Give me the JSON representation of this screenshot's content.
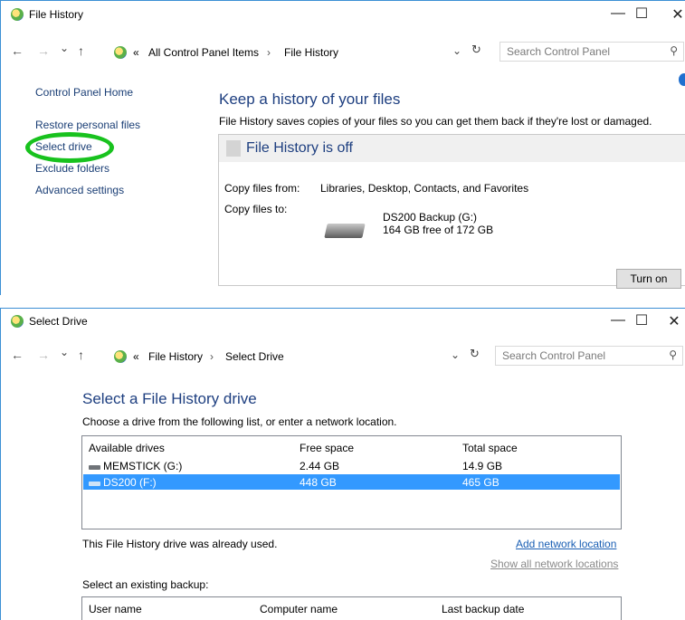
{
  "win1": {
    "title": "File History",
    "controls": {
      "minimize": "—",
      "maximize": "☐",
      "close": "✕"
    },
    "nav": {
      "back": "←",
      "forward": "→",
      "recent": "⌄",
      "up": "↑",
      "prefix": "«",
      "sep": "›",
      "dropdown": "⌄",
      "refresh": "↻"
    },
    "breadcrumb": [
      "All Control Panel Items",
      "File History"
    ],
    "search_placeholder": "Search Control Panel",
    "sidebar": [
      "Control Panel Home",
      "Restore personal files",
      "Select drive",
      "Exclude folders",
      "Advanced settings"
    ],
    "heading": "Keep a history of your files",
    "description": "File History saves copies of your files so you can get them back if they're lost or damaged.",
    "status_title": "File History is off",
    "copy_from_label": "Copy files from:",
    "copy_from_value": "Libraries, Desktop, Contacts, and Favorites",
    "copy_to_label": "Copy files to:",
    "drive_name": "DS200 Backup (G:)",
    "drive_space": "164 GB free of 172 GB",
    "turn_on": "Turn on",
    "highlight_color": "#18c21e"
  },
  "win2": {
    "title": "Select Drive",
    "controls": {
      "minimize": "—",
      "maximize": "☐",
      "close": "✕"
    },
    "nav": {
      "back": "←",
      "forward": "→",
      "recent": "⌄",
      "up": "↑",
      "prefix": "«",
      "sep": "›",
      "dropdown": "⌄",
      "refresh": "↻"
    },
    "breadcrumb": [
      "File History",
      "Select Drive"
    ],
    "search_placeholder": "Search Control Panel",
    "heading": "Select a File History drive",
    "instruction": "Choose a drive from the following list, or enter a network location.",
    "columns": [
      "Available drives",
      "Free space",
      "Total space"
    ],
    "drives": [
      {
        "name": "MEMSTICK (G:)",
        "free": "2.44 GB",
        "total": "14.9 GB"
      },
      {
        "name": "DS200 (F:)",
        "free": "448 GB",
        "total": "465 GB"
      }
    ],
    "status_note": "This File History drive was already used.",
    "add_network": "Add network location",
    "show_all": "Show all network locations",
    "existing_label": "Select an existing backup:",
    "backup_columns": [
      "User name",
      "Computer name",
      "Last backup date"
    ],
    "selection_color": "#3399ff"
  }
}
